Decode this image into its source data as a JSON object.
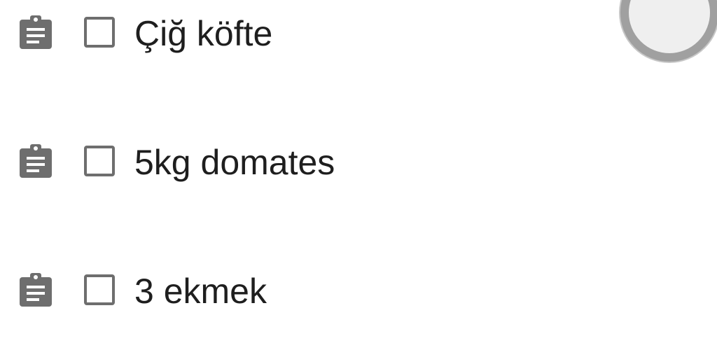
{
  "shopping_list": {
    "items": [
      {
        "label": "Çiğ köfte",
        "checked": false,
        "icon": "clipboard-icon"
      },
      {
        "label": "5kg domates",
        "checked": false,
        "icon": "clipboard-icon"
      },
      {
        "label": "3 ekmek",
        "checked": false,
        "icon": "clipboard-icon"
      }
    ]
  },
  "colors": {
    "icon": "#6e6e6e",
    "text": "#1e1e1e",
    "fab_ring": "#a0a0a0",
    "fab_fill": "#efefef"
  }
}
